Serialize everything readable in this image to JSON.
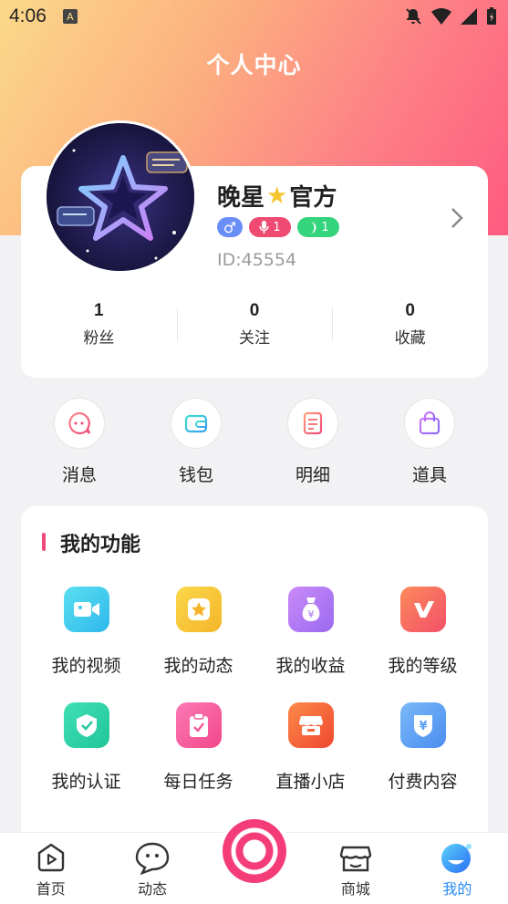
{
  "status": {
    "time": "4:06",
    "app_indicator": "A"
  },
  "header": {
    "title": "个人中心"
  },
  "profile": {
    "nickname_before": "晚星",
    "nickname_after": "官方",
    "gender_symbol": "♂",
    "mic_count": "1",
    "level_count": "1",
    "user_id": "ID:45554"
  },
  "stats": [
    {
      "value": "1",
      "label": "粉丝"
    },
    {
      "value": "0",
      "label": "关注"
    },
    {
      "value": "0",
      "label": "收藏"
    }
  ],
  "quick_actions": [
    {
      "label": "消息",
      "icon": "message-icon"
    },
    {
      "label": "钱包",
      "icon": "wallet-icon"
    },
    {
      "label": "明细",
      "icon": "details-icon"
    },
    {
      "label": "道具",
      "icon": "props-bag-icon"
    }
  ],
  "functions": {
    "title": "我的功能",
    "items": [
      {
        "label": "我的视频",
        "icon": "video-icon",
        "color": "#3fd0e8"
      },
      {
        "label": "我的动态",
        "icon": "star-icon",
        "color": "#f8c53a"
      },
      {
        "label": "我的收益",
        "icon": "money-bag-icon",
        "color": "#b87cf5"
      },
      {
        "label": "我的等级",
        "icon": "vip-icon",
        "color": "#f46a5a"
      },
      {
        "label": "我的认证",
        "icon": "shield-check-icon",
        "color": "#2fd4a8"
      },
      {
        "label": "每日任务",
        "icon": "clipboard-check-icon",
        "color": "#f45c9a"
      },
      {
        "label": "直播小店",
        "icon": "shop-icon",
        "color": "#f5643c"
      },
      {
        "label": "付费内容",
        "icon": "yen-shield-icon",
        "color": "#5aa0f5"
      }
    ]
  },
  "tabbar": {
    "items": [
      {
        "label": "首页",
        "icon": "home-play-icon"
      },
      {
        "label": "动态",
        "icon": "chat-face-icon"
      },
      {
        "label": "商城",
        "icon": "store-icon"
      },
      {
        "label": "我的",
        "icon": "profile-face-icon"
      }
    ],
    "active_index": 3
  },
  "colors": {
    "accent": "#f43d78",
    "tab_active": "#2a8cf5"
  }
}
